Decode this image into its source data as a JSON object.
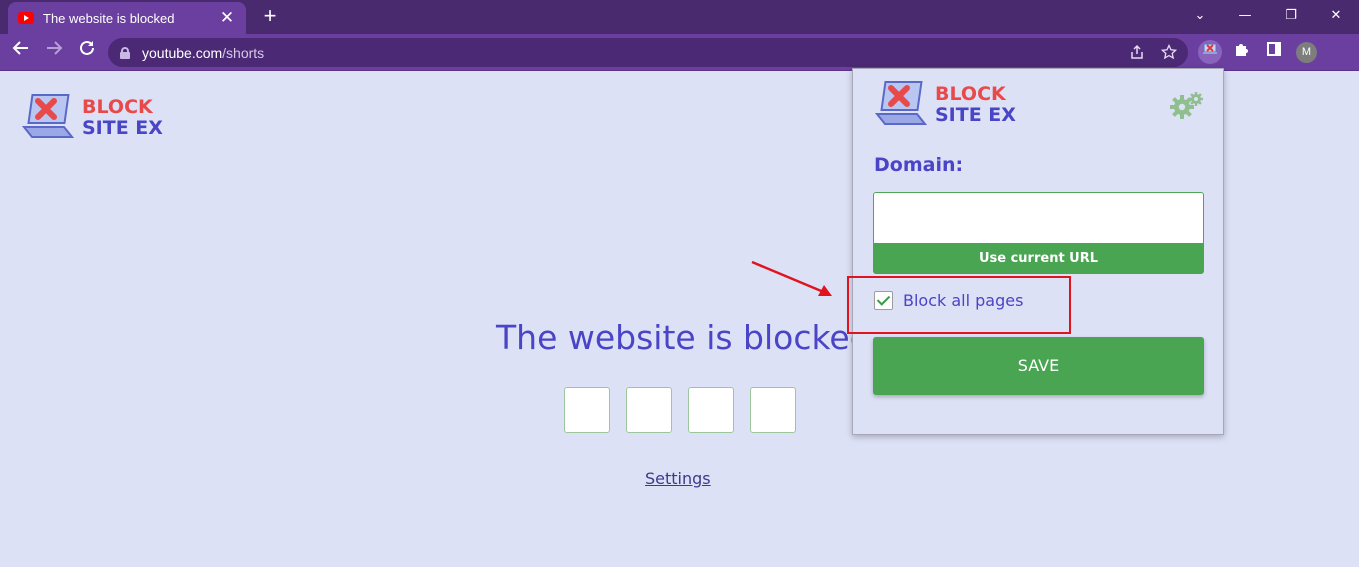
{
  "browser": {
    "tab_title": "The website is blocked",
    "tab_close": "✕",
    "new_tab": "+",
    "url_host": "youtube.com",
    "url_path": "/shorts",
    "profile_initial": "M",
    "window_controls": [
      "⌄",
      "—",
      "❐",
      "✕"
    ]
  },
  "page": {
    "logo_line1": "BLOCK",
    "logo_line2": "SITE EX",
    "title": "The website is blocked",
    "pin_boxes": 4,
    "settings_link": "Settings"
  },
  "popup": {
    "logo_line1": "BLOCK",
    "logo_line2": "SITE EX",
    "domain_label": "Domain:",
    "domain_value": "",
    "use_current_url": "Use current URL",
    "block_all_pages_label": "Block all pages",
    "block_all_pages_checked": true,
    "save_label": "SAVE"
  },
  "colors": {
    "accent_green": "#4aa553",
    "brand_red": "#e84a4a",
    "brand_blue": "#4a44c6",
    "highlight_red": "#e0141e",
    "chrome_purple": "#6b3fa0"
  }
}
